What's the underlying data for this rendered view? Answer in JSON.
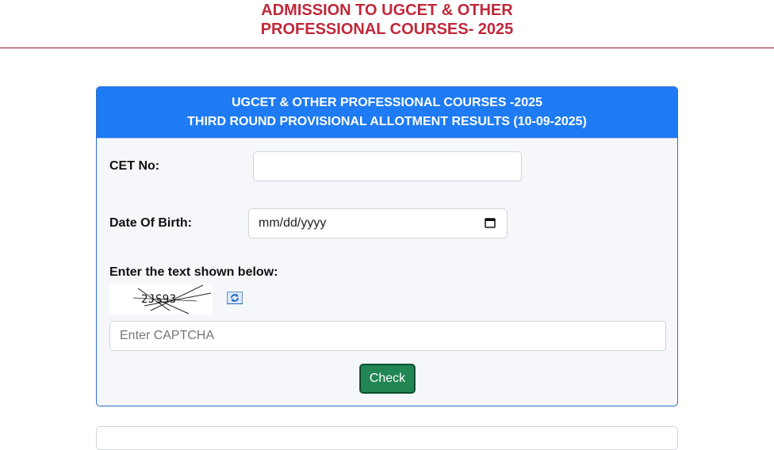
{
  "page": {
    "title_line1": "ADMISSION TO UGCET & OTHER",
    "title_line2": "PROFESSIONAL COURSES- 2025"
  },
  "card": {
    "header_line1": "UGCET & OTHER PROFESSIONAL COURSES -2025",
    "header_line2": "THIRD ROUND PROVISIONAL ALLOTMENT RESULTS (10-09-2025)"
  },
  "form": {
    "cet_label": "CET No:",
    "cet_value": "",
    "dob_label": "Date Of Birth:",
    "dob_value": "mm/dd/yyyy",
    "captcha_label": "Enter the text shown below:",
    "captcha_text": "2JS93",
    "captcha_placeholder": "Enter CAPTCHA",
    "check_label": "Check"
  },
  "colors": {
    "title_red": "#c0283a",
    "header_blue": "#1e7bf4",
    "button_green": "#218554"
  },
  "icons": {
    "calendar": "calendar-icon",
    "refresh": "refresh-icon"
  }
}
